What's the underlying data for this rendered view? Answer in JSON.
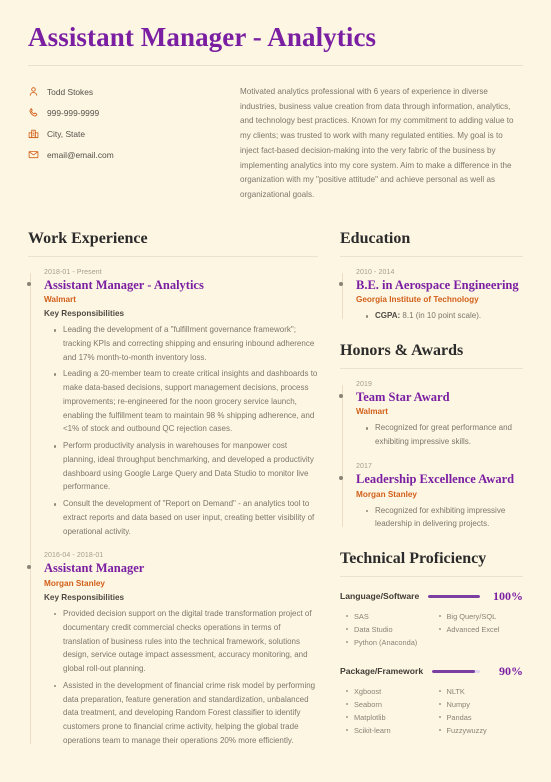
{
  "header": {
    "title": "Assistant Manager - Analytics",
    "contacts": [
      {
        "icon": "person-icon",
        "text": "Todd Stokes"
      },
      {
        "icon": "phone-icon",
        "text": "999-999-9999"
      },
      {
        "icon": "building-icon",
        "text": "City, State"
      },
      {
        "icon": "email-icon",
        "text": "email@email.com"
      }
    ],
    "summary": "Motivated analytics professional with 6 years of experience in diverse industries, business value creation from data through information, analytics, and technology best practices. Known for my commitment to adding value to my clients; was trusted to work with many regulated entities. My goal is to inject fact-based decision-making into the very fabric of the business by implementing analytics into my core system. Aim to make a difference in the organization with my \"positive attitude\" and achieve personal as well as organizational goals."
  },
  "work_experience": {
    "section_title": "Work Experience",
    "entries": [
      {
        "date": "2018-01 - Present",
        "title": "Assistant Manager - Analytics",
        "org": "Walmart",
        "subhead": "Key Responsibilities",
        "bullets": [
          "Leading the development of a \"fulfillment governance framework\"; tracking KPIs and correcting shipping and ensuring inbound adherence and 17% month-to-month inventory loss.",
          "Leading a 20-member team to create critical insights and dashboards to make data-based decisions, support management decisions, process improvements; re-engineered for the noon grocery service launch, enabling the fulfillment team to maintain 98 % shipping adherence, and <1% of stock and outbound QC rejection cases.",
          "Perform productivity analysis in warehouses for manpower cost planning, ideal throughput benchmarking, and developed a productivity dashboard using Google Large Query and Data Studio to monitor live performance.",
          "Consult the development of \"Report on Demand\" - an analytics tool to extract reports and data based on user input, creating better visibility of operational activity."
        ]
      },
      {
        "date": "2016-04 - 2018-01",
        "title": "Assistant Manager",
        "org": "Morgan Stanley",
        "subhead": "Key Responsibilities",
        "bullets": [
          "Provided decision support on the digital trade transformation project of documentary credit commercial checks operations in terms of translation of business rules into the technical framework, solutions design, service outage impact assessment, accuracy monitoring, and global roll-out planning.",
          "Assisted in the development of financial crime risk model by performing data preparation, feature generation and standardization, unbalanced data treatment, and developing Random Forest classifier to identify customers prone to financial crime activity, helping the global trade operations team to manage their operations 20% more efficiently."
        ]
      }
    ]
  },
  "education": {
    "section_title": "Education",
    "entries": [
      {
        "date": "2010 - 2014",
        "title": "B.E. in Aerospace Engineering",
        "org": "Georgia Institute of Technology",
        "bullets_rich": [
          {
            "bold": "CGPA:",
            "rest": " 8.1 (in 10 point scale)."
          }
        ]
      }
    ]
  },
  "honors": {
    "section_title": "Honors & Awards",
    "entries": [
      {
        "date": "2019",
        "title": "Team Star Award",
        "org": "Walmart",
        "bullets": [
          "Recognized for great performance and exhibiting impressive skills."
        ]
      },
      {
        "date": "2017",
        "title": "Leadership Excellence Award",
        "org": "Morgan Stanley",
        "bullets": [
          "Recognized for exhibiting impressive leadership in delivering projects."
        ]
      }
    ]
  },
  "technical_proficiency": {
    "section_title": "Technical Proficiency",
    "skills": [
      {
        "name": "Language/Software",
        "percent_label": "100%",
        "percent_value": 100,
        "items_left": [
          "SAS",
          "Data Studio",
          "Python (Anaconda)"
        ],
        "items_right": [
          "Big Query/SQL",
          "Advanced Excel"
        ]
      },
      {
        "name": "Package/Framework",
        "percent_label": "90%",
        "percent_value": 90,
        "items_left": [
          "Xgboost",
          "Seaborn",
          "Matplotlib",
          "Scikit-learn"
        ],
        "items_right": [
          "NLTK",
          "Numpy",
          "Pandas",
          "Fuzzywuzzy"
        ]
      }
    ]
  },
  "colors": {
    "background": "#FDF6E3",
    "accent_purple": "#7B1FA2",
    "accent_orange": "#D2601A",
    "body_text": "#7d776c",
    "heading_text": "#2b2b2b"
  }
}
